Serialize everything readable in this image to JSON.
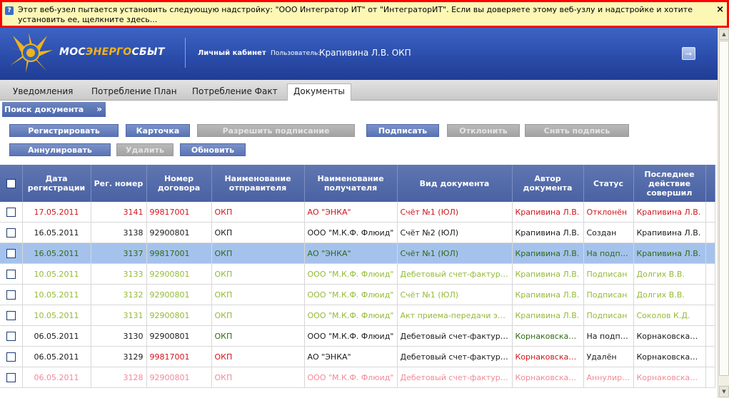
{
  "infobar": {
    "message": "Этот веб-узел пытается установить следующую надстройку: \"ООО Интегратор ИТ\" от \"ИнтеграторИТ\". Если вы доверяете этому веб-узлу и надстройке и хотите установить ее, щелкните здесь...",
    "close": "×"
  },
  "header": {
    "logo_part1": "МОС",
    "logo_part2": "ЭНЕРГО",
    "logo_part3": "СБЫТ",
    "cabinet_label": "Личный кабинет",
    "user_prefix": "Пользователь:",
    "user_name": "Крапивина Л.В. ОКП",
    "logout_icon": "→"
  },
  "tabs": [
    {
      "label": "Уведомления"
    },
    {
      "label": "Потребление План"
    },
    {
      "label": "Потребление Факт"
    },
    {
      "label": "Документы",
      "active": true
    }
  ],
  "search_toggle": {
    "label": "Поиск документа",
    "chevron": "»"
  },
  "buttons": {
    "register": "Регистрировать",
    "card": "Карточка",
    "allow_sign": "Разрешить подписание",
    "sign": "Подписать",
    "reject": "Отклонить",
    "remove_sign": "Снять подпись",
    "annul": "Аннулировать",
    "delete": "Удалить",
    "refresh": "Обновить"
  },
  "columns": {
    "reg_date": "Дата регистрации",
    "reg_num": "Рег. номер",
    "contract": "Номер договора",
    "sender": "Наименование отправителя",
    "receiver": "Наименование получателя",
    "doc_type": "Вид документа",
    "author": "Автор документа",
    "status": "Статус",
    "last_action": "Последнее действие совершил"
  },
  "rows": [
    {
      "date": "17.05.2011",
      "reg": "3141",
      "contract": "99817001",
      "sender": "ОКП",
      "receiver": "АО \"ЭНКА\"",
      "type": "Счёт №1 (ЮЛ)",
      "author": "Крапивина Л.В.",
      "status": "Отклонён",
      "last": "Крапивина Л.В."
    },
    {
      "date": "16.05.2011",
      "reg": "3138",
      "contract": "92900801",
      "sender": "ОКП",
      "receiver": "ООО \"М.К.Ф. Флюид\"",
      "type": "Счёт №2 (ЮЛ)",
      "author": "Крапивина Л.В.",
      "status": "Создан",
      "last": "Крапивина Л.В."
    },
    {
      "date": "16.05.2011",
      "reg": "3137",
      "contract": "99817001",
      "sender": "ОКП",
      "receiver": "АО \"ЭНКА\"",
      "type": "Счёт №1 (ЮЛ)",
      "author": "Крапивина Л.В.",
      "status": "На подпис...",
      "last": "Крапивина Л.В."
    },
    {
      "date": "10.05.2011",
      "reg": "3133",
      "contract": "92900801",
      "sender": "ОКП",
      "receiver": "ООО \"М.К.Ф. Флюид\"",
      "type": "Дебетовый счет-фактура (...",
      "author": "Крапивина Л.В.",
      "status": "Подписан",
      "last": "Долгих В.В."
    },
    {
      "date": "10.05.2011",
      "reg": "3132",
      "contract": "92900801",
      "sender": "ОКП",
      "receiver": "ООО \"М.К.Ф. Флюид\"",
      "type": "Счёт №1 (ЮЛ)",
      "author": "Крапивина Л.В.",
      "status": "Подписан",
      "last": "Долгих В.В."
    },
    {
      "date": "10.05.2011",
      "reg": "3131",
      "contract": "92900801",
      "sender": "ОКП",
      "receiver": "ООО \"М.К.Ф. Флюид\"",
      "type": "Акт приема-передачи элек...",
      "author": "Крапивина Л.В.",
      "status": "Подписан",
      "last": "Соколов К.Д."
    },
    {
      "date": "06.05.2011",
      "reg": "3130",
      "contract": "92900801",
      "sender": "ОКП",
      "receiver": "ООО \"М.К.Ф. Флюид\"",
      "type": "Дебетовый счет-фактура (...",
      "author": "Корнаковская Л...",
      "status": "На подпис...",
      "last": "Корнаковская Л..."
    },
    {
      "date": "06.05.2011",
      "reg": "3129",
      "contract": "99817001",
      "sender": "ОКП",
      "receiver": "АО \"ЭНКА\"",
      "type": "Дебетовый счет-фактура (...",
      "author": "Корнаковская Л...",
      "status": "Удалён",
      "last": "Корнаковская Л..."
    },
    {
      "date": "06.05.2011",
      "reg": "3128",
      "contract": "92900801",
      "sender": "ОКП",
      "receiver": "ООО \"М.К.Ф. Флюид\"",
      "type": "Дебетовый счет-фактура (...",
      "author": "Корнаковская Л...",
      "status": "Аннулиро...",
      "last": "Корнаковская Л..."
    }
  ]
}
